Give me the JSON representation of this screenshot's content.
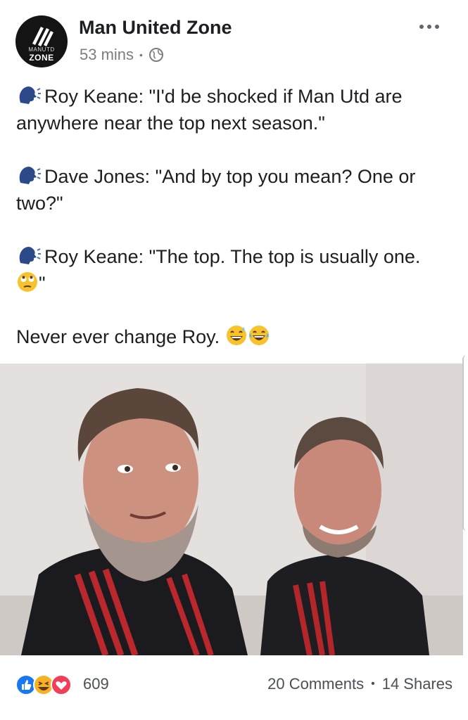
{
  "post": {
    "page_name": "Man United Zone",
    "avatar_line1": "MANUTD",
    "avatar_line2": "ZONE",
    "time": "53 mins",
    "separator": "•",
    "privacy_icon": "globe-icon",
    "more_icon": "more-options-icon"
  },
  "body": {
    "line1": "Roy Keane: \"I'd be shocked if Man Utd are anywhere near the top next season.\"",
    "line2": "Dave Jones: \"And by top you mean? One or two?\"",
    "line3": "Roy Keane: \"The top. The top is usually one.",
    "line3_end": "\"",
    "line4": "Never ever change Roy."
  },
  "reactions": {
    "icons": [
      "like-icon",
      "haha-icon",
      "love-icon"
    ],
    "count": "609",
    "comments": "20 Comments",
    "separator": "•",
    "shares": "14 Shares"
  },
  "colors": {
    "like": "#1877f2",
    "love": "#f33e58",
    "haha": "#f7b125",
    "text": "#1c1e21",
    "muted": "#7a7d82"
  }
}
